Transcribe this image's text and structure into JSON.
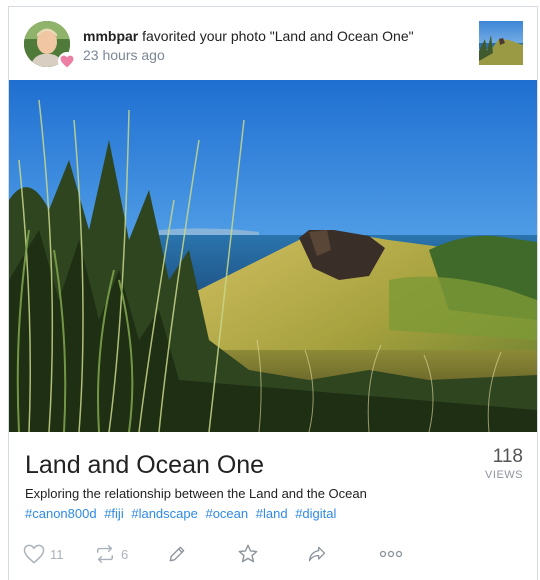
{
  "notification": {
    "username": "mmbpar",
    "action_text": " favorited your photo ",
    "photo_title_quoted": "\"Land and Ocean One\"",
    "time_ago": "23 hours ago"
  },
  "photo": {
    "title": "Land and Ocean One",
    "description": "Exploring the relationship between the Land and the Ocean",
    "views_count": "118",
    "views_label": "VIEWS",
    "tags": [
      "#canon800d",
      "#fiji",
      "#landscape",
      "#ocean",
      "#land",
      "#digital"
    ]
  },
  "actions": {
    "like_count": "11",
    "repost_count": "6"
  },
  "icons": {
    "badge": "heart-icon",
    "like": "heart-outline-icon",
    "repost": "repost-icon",
    "edit": "pencil-icon",
    "favorite": "star-icon",
    "share": "share-arrow-icon",
    "more": "more-dots-icon"
  },
  "colors": {
    "badge_pink": "#ec7fa3",
    "link_blue": "#2e8ae6",
    "icon_grey": "#a9b1ba",
    "text_dark": "#222222",
    "muted_grey": "#7b8794"
  }
}
